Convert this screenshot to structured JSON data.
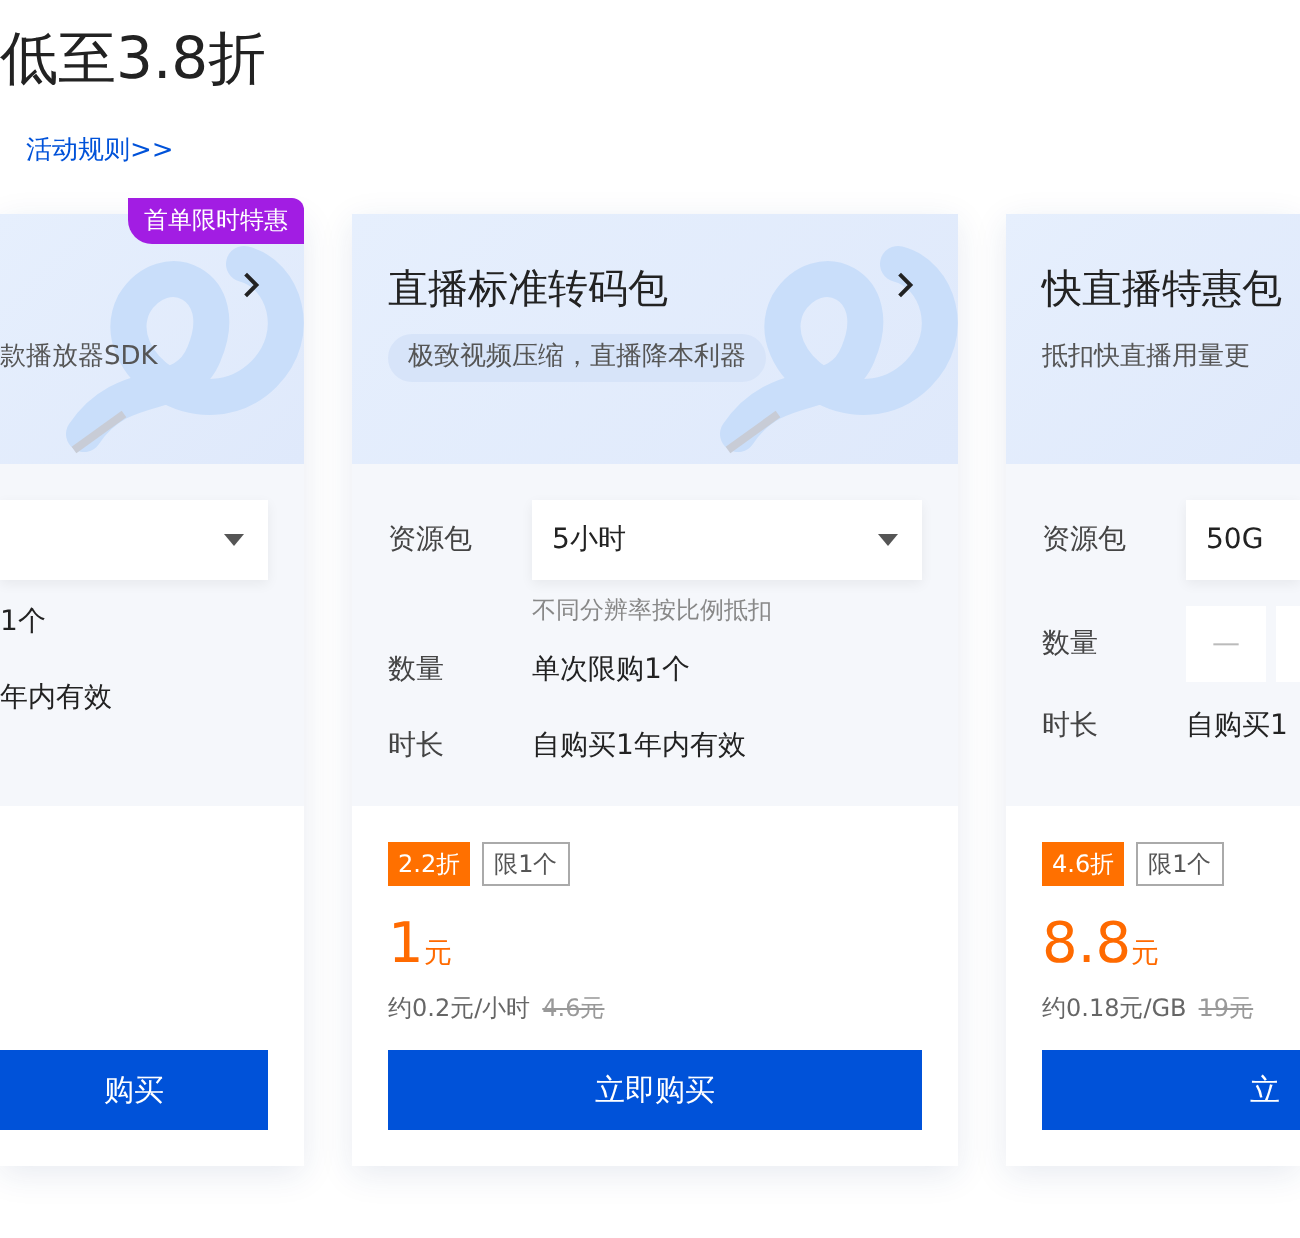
{
  "header": {
    "title": "低至3.8折",
    "rules_link": "活动规则>>"
  },
  "cards": [
    {
      "kind": "clipped-left",
      "badge": "首单限时特惠",
      "chevron": true,
      "subtitle": "款播放器SDK",
      "subtitle_pill": false,
      "rows": [
        {
          "kind": "select"
        },
        {
          "kind": "text",
          "value": "1个"
        },
        {
          "kind": "text",
          "value": "年内有效"
        }
      ],
      "button": "购买"
    },
    {
      "kind": "full",
      "title": "直播标准转码包",
      "chevron": true,
      "subtitle": "极致视频压缩，直播降本利器",
      "subtitle_pill": true,
      "rows": [
        {
          "kind": "select",
          "label": "资源包",
          "value": "5小时",
          "hint": "不同分辨率按比例抵扣"
        },
        {
          "kind": "text",
          "label": "数量",
          "value": "单次限购1个"
        },
        {
          "kind": "text",
          "label": "时长",
          "value": "自购买1年内有效"
        }
      ],
      "discount": "2.2折",
      "limit": "限1个",
      "price": "1",
      "unit": "元",
      "unit_price": "约0.2元/小时",
      "original_price": "4.6元",
      "button": "立即购买"
    },
    {
      "kind": "clipped-right",
      "title": "快直播特惠包",
      "chevron": false,
      "subtitle": "抵扣快直播用量更",
      "subtitle_pill": false,
      "rows": [
        {
          "kind": "select",
          "label": "资源包",
          "value": "50G"
        },
        {
          "kind": "stepper",
          "label": "数量",
          "minus": "—"
        },
        {
          "kind": "text",
          "label": "时长",
          "value": "自购买1"
        }
      ],
      "discount": "4.6折",
      "limit": "限1个",
      "price": "8.8",
      "unit": "元",
      "unit_price": "约0.18元/GB",
      "original_price": "19元",
      "button": "立"
    }
  ]
}
